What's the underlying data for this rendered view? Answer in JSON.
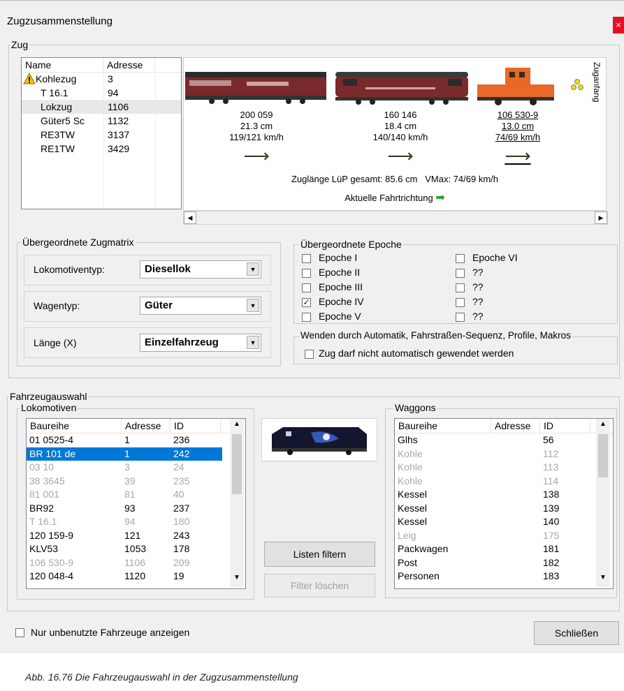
{
  "window": {
    "title": "Zugzusammenstellung",
    "close_glyph": "×"
  },
  "zug": {
    "group_label": "Zug",
    "table": {
      "col_name": "Name",
      "col_adresse": "Adresse",
      "rows": [
        {
          "name": "Kohlezug",
          "adresse": "3",
          "warning": true
        },
        {
          "name": "T 16.1",
          "adresse": "94"
        },
        {
          "name": "Lokzug",
          "adresse": "1106"
        },
        {
          "name": "Güter5 Sc",
          "adresse": "1132"
        },
        {
          "name": "RE3TW",
          "adresse": "3137"
        },
        {
          "name": "RE1TW",
          "adresse": "3429"
        }
      ]
    },
    "vehicles": [
      {
        "number": "200 059",
        "length": "21.3 cm",
        "speed": "119/121 km/h",
        "color": "#7a2a2c"
      },
      {
        "number": "160 146",
        "length": "18.4 cm",
        "speed": "140/140 km/h",
        "color": "#7a2a2c"
      },
      {
        "number": "106 530-9",
        "length": "13.0 cm",
        "speed": "74/69 km/h",
        "color": "#e8682a"
      }
    ],
    "zuganfang_label": "Zuganfang",
    "summary": "Zuglänge LüP gesamt: 85.6 cm   VMax: 74/69 km/h",
    "direction_label": "Aktuelle Fahrtrichtung",
    "arrow_glyph": "⟶",
    "green_arrow_glyph": "➡",
    "scroll_left": "◀",
    "scroll_right": "▶"
  },
  "zugmatrix": {
    "group_label": "Übergeordnete Zugmatrix",
    "lokomotiventyp_label": "Lokomotiventyp:",
    "lokomotiventyp_value": "Diesellok",
    "wagentyp_label": "Wagentyp:",
    "wagentyp_value": "Güter",
    "laenge_label": "Länge (X)",
    "laenge_value": "Einzelfahrzeug",
    "dropdown_glyph": "▼"
  },
  "epoche": {
    "group_label": "Übergeordnete Epoche",
    "left": [
      {
        "label": "Epoche I",
        "checked": false
      },
      {
        "label": "Epoche II",
        "checked": false
      },
      {
        "label": "Epoche III",
        "checked": false
      },
      {
        "label": "Epoche IV",
        "checked": true
      },
      {
        "label": "Epoche V",
        "checked": false
      }
    ],
    "right": [
      {
        "label": "Epoche VI",
        "checked": false
      },
      {
        "label": "??",
        "checked": false
      },
      {
        "label": "??",
        "checked": false
      },
      {
        "label": "??",
        "checked": false
      },
      {
        "label": "??",
        "checked": false
      }
    ],
    "check_glyph": "✓"
  },
  "wenden": {
    "group_label": "Wenden durch Automatik, Fahrstraßen-Sequenz, Profile, Makros",
    "checkbox_label": "Zug darf nicht automatisch gewendet werden"
  },
  "fahrzeugauswahl": {
    "group_label": "Fahrzeugauswahl",
    "lok": {
      "group_label": "Lokomotiven",
      "col_baureihe": "Baureihe",
      "col_adresse": "Adresse",
      "col_id": "ID",
      "rows": [
        {
          "baureihe": "01 0525-4",
          "adresse": "1",
          "id": "236",
          "state": "normal"
        },
        {
          "baureihe": "BR 101 de",
          "adresse": "1",
          "id": "242",
          "state": "selected"
        },
        {
          "baureihe": "03 10",
          "adresse": "3",
          "id": "24",
          "state": "dim"
        },
        {
          "baureihe": "38 3645",
          "adresse": "39",
          "id": "235",
          "state": "dim"
        },
        {
          "baureihe": "81 001",
          "adresse": "81",
          "id": "40",
          "state": "dim"
        },
        {
          "baureihe": "BR92",
          "adresse": "93",
          "id": "237",
          "state": "normal"
        },
        {
          "baureihe": "T 16.1",
          "adresse": "94",
          "id": "180",
          "state": "dim"
        },
        {
          "baureihe": "120 159-9",
          "adresse": "121",
          "id": "243",
          "state": "normal"
        },
        {
          "baureihe": "KLV53",
          "adresse": "1053",
          "id": "178",
          "state": "normal"
        },
        {
          "baureihe": "106 530-9",
          "adresse": "1106",
          "id": "209",
          "state": "dim"
        },
        {
          "baureihe": "120 048-4",
          "adresse": "1120",
          "id": "19",
          "state": "normal"
        }
      ]
    },
    "waggons": {
      "group_label": "Waggons",
      "col_baureihe": "Baureihe",
      "col_adresse": "Adresse",
      "col_id": "ID",
      "rows": [
        {
          "baureihe": "Glhs",
          "adresse": "",
          "id": "56",
          "state": "normal"
        },
        {
          "baureihe": "Kohle",
          "adresse": "",
          "id": "112",
          "state": "dim"
        },
        {
          "baureihe": "Kohle",
          "adresse": "",
          "id": "113",
          "state": "dim"
        },
        {
          "baureihe": "Kohle",
          "adresse": "",
          "id": "114",
          "state": "dim"
        },
        {
          "baureihe": "Kessel",
          "adresse": "",
          "id": "138",
          "state": "normal"
        },
        {
          "baureihe": "Kessel",
          "adresse": "",
          "id": "139",
          "state": "normal"
        },
        {
          "baureihe": "Kessel",
          "adresse": "",
          "id": "140",
          "state": "normal"
        },
        {
          "baureihe": "Leig",
          "adresse": "",
          "id": "175",
          "state": "dim"
        },
        {
          "baureihe": "Packwagen",
          "adresse": "",
          "id": "181",
          "state": "normal"
        },
        {
          "baureihe": "Post",
          "adresse": "",
          "id": "182",
          "state": "normal"
        },
        {
          "baureihe": "Personen",
          "adresse": "",
          "id": "183",
          "state": "normal"
        }
      ]
    },
    "listen_filtern": "Listen filtern",
    "filter_loeschen": "Filter löschen",
    "scroll_up": "▲",
    "scroll_down": "▼"
  },
  "footer": {
    "unbenutzt_label": "Nur unbenutzte Fahrzeuge anzeigen",
    "schliessen": "Schließen"
  },
  "caption": "Abb. 16.76  Die Fahrzeugauswahl in der Zugzusammenstellung"
}
